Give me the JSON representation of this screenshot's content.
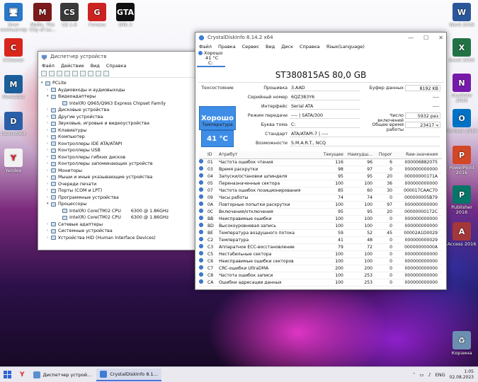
{
  "desktop": {
    "icons_left": [
      {
        "label": "Этот компьютер",
        "icon": "computer-icon"
      },
      {
        "label": "Mafia. The City of Lo...",
        "icon": "mafia-game-icon"
      },
      {
        "label": "CS 1.6",
        "icon": "cs-game-icon"
      },
      {
        "label": "Готика",
        "icon": "gothic-game-icon"
      },
      {
        "label": "GTA 3",
        "icon": "gta-game-icon"
      },
      {
        "label": "CCleaner",
        "icon": "ccleaner-icon"
      },
      {
        "label": "MediaGet",
        "icon": "mediaget-icon"
      },
      {
        "label": "DiskInfo64",
        "icon": "diskinfo-icon"
      },
      {
        "label": "Yandex",
        "icon": "yandex-icon"
      }
    ],
    "icons_right": [
      {
        "label": "Word 2016",
        "icon": "word-icon",
        "color": "#2b579a",
        "glyph": "W"
      },
      {
        "label": "Excel 2016",
        "icon": "excel-icon",
        "color": "#217346",
        "glyph": "X"
      },
      {
        "label": "OneNote 2016",
        "icon": "onenote-icon",
        "color": "#7719aa",
        "glyph": "N"
      },
      {
        "label": "Outlook 2016",
        "icon": "outlook-icon",
        "color": "#0072c6",
        "glyph": "O"
      },
      {
        "label": "PowerPoint 2016",
        "icon": "powerpoint-icon",
        "color": "#d24726",
        "glyph": "P"
      },
      {
        "label": "Publisher 2016",
        "icon": "publisher-icon",
        "color": "#077568",
        "glyph": "P"
      },
      {
        "label": "Access 2016",
        "icon": "access-icon",
        "color": "#a4373a",
        "glyph": "A"
      },
      {
        "label": "Корзина",
        "icon": "recycle-bin-icon",
        "color": "#6c8fb0",
        "glyph": "♻"
      }
    ]
  },
  "devmgr": {
    "title": "Диспетчер устройств",
    "menu": [
      "Файл",
      "Действие",
      "Вид",
      "Справка"
    ],
    "root": "PCLite",
    "tree": [
      {
        "label": "Аудиовходы и аудиовыходы",
        "expanded": false
      },
      {
        "label": "Видеоадаптеры",
        "expanded": true
      },
      {
        "label": "Intel(R) Q965/Q963 Express Chipset Family",
        "child": true
      },
      {
        "label": "Дисковые устройства",
        "expanded": false
      },
      {
        "label": "Другие устройства",
        "expanded": false
      },
      {
        "label": "Звуковые, игровые и видеоустройства",
        "expanded": false
      },
      {
        "label": "Клавиатуры",
        "expanded": false
      },
      {
        "label": "Компьютер",
        "expanded": false
      },
      {
        "label": "Контроллеры IDE ATA/ATAPI",
        "expanded": false
      },
      {
        "label": "Контроллеры USB",
        "expanded": false
      },
      {
        "label": "Контроллеры гибких дисков",
        "expanded": false
      },
      {
        "label": "Контроллеры запоминающих устройств",
        "expanded": false
      },
      {
        "label": "Мониторы",
        "expanded": false
      },
      {
        "label": "Мыши и иные указывающие устройства",
        "expanded": false
      },
      {
        "label": "Очереди печати",
        "expanded": false
      },
      {
        "label": "Порты (COM и LPT)",
        "expanded": false
      },
      {
        "label": "Программные устройства",
        "expanded": false
      },
      {
        "label": "Процессоры",
        "expanded": true
      },
      {
        "label": "Intel(R) Core(TM)2 CPU",
        "value": "6300 @ 1.86GHz",
        "child": true
      },
      {
        "label": "Intel(R) Core(TM)2 CPU",
        "value": "6300 @ 1.86GHz",
        "child": true
      },
      {
        "label": "Сетевые адаптеры",
        "expanded": false
      },
      {
        "label": "Системные устройства",
        "expanded": false
      },
      {
        "label": "Устройства HID (Human Interface Devices)",
        "expanded": false
      }
    ]
  },
  "cdi": {
    "title": "CrystalDiskInfo 8.14.2 x64",
    "menu": [
      "Файл",
      "Правка",
      "Сервис",
      "Вид",
      "Диск",
      "Справка",
      "Язык(Language)"
    ],
    "tab": {
      "status": "Хорошо",
      "temp": "41 °C",
      "letter": "C:"
    },
    "disk_title": "ST380815AS 80,0 GB",
    "labels": {
      "health": "Техсостояние",
      "temperature": "Температура",
      "firmware": "Прошивка",
      "serial": "Серийный номер",
      "interface": "Интерфейс",
      "transfer": "Режим передачи",
      "drive_letter": "Буква тома",
      "standard": "Стандарт",
      "features": "Возможности",
      "buffer": "Буфер данных",
      "power_on_count": "Число включений",
      "power_on_hours": "Общее время работы"
    },
    "values": {
      "health": "Хорошо",
      "temperature": "41 °C",
      "firmware": "3.AAD",
      "serial": "6QZ383Y6",
      "interface": "Serial ATA",
      "transfer": "---- | SATA/300",
      "drive_letter": "C:",
      "standard": "ATA/ATAPI-7 | ----",
      "features": "S.M.A.R.T., NCQ",
      "buffer": "8192 KB",
      "blank1": "----",
      "blank2": "----",
      "power_on_count": "5932 раз",
      "power_on_hours": "23417 ч"
    },
    "headers": [
      "ID",
      "Атрибут",
      "Текущее",
      "Наихудш...",
      "Порог",
      "Raw-значения"
    ],
    "rows": [
      [
        "01",
        "Частота ошибок чтения",
        "116",
        "96",
        "6",
        "000006882075"
      ],
      [
        "03",
        "Время раскрутки",
        "98",
        "97",
        "0",
        "000000000000"
      ],
      [
        "04",
        "Запуски/остановки шпинделя",
        "95",
        "95",
        "20",
        "00000000171A"
      ],
      [
        "05",
        "Переназначенные сектора",
        "100",
        "100",
        "36",
        "000000000000"
      ],
      [
        "07",
        "Частота ошибок позиционирования",
        "85",
        "60",
        "30",
        "000017CAAC70"
      ],
      [
        "09",
        "Часы работы",
        "74",
        "74",
        "0",
        "000000005B79"
      ],
      [
        "0A",
        "Повторные попытки раскрутки",
        "100",
        "100",
        "97",
        "000000000000"
      ],
      [
        "0C",
        "Включения/отключения",
        "95",
        "95",
        "20",
        "00000000172C"
      ],
      [
        "BB",
        "Неисправимые ошибки",
        "100",
        "100",
        "0",
        "000000000000"
      ],
      [
        "BD",
        "Высокоуровневая запись",
        "100",
        "100",
        "0",
        "000000000000"
      ],
      [
        "BE",
        "Температура воздушного потока",
        "59",
        "52",
        "45",
        "00002A1D0029"
      ],
      [
        "C2",
        "Температура",
        "41",
        "48",
        "0",
        "000000000029"
      ],
      [
        "C3",
        "Аппаратное ECC-восстановление",
        "79",
        "72",
        "0",
        "00000000000A"
      ],
      [
        "C5",
        "Нестабильные сектора",
        "100",
        "100",
        "0",
        "000000000000"
      ],
      [
        "C6",
        "Неисправимые ошибки секторов",
        "100",
        "100",
        "0",
        "000000000000"
      ],
      [
        "C7",
        "CRC-ошибки UltraDMA",
        "200",
        "200",
        "0",
        "000000000000"
      ],
      [
        "C8",
        "Частота ошибок записи",
        "100",
        "253",
        "0",
        "000000000000"
      ],
      [
        "CA",
        "Ошибки адресации данных",
        "100",
        "253",
        "0",
        "000000000000"
      ]
    ]
  },
  "taskbar": {
    "items": [
      {
        "label": "Диспетчер устрой...",
        "icon": "devmgr-taskbar-icon",
        "active": false
      },
      {
        "label": "CrystalDiskInfo 8.1...",
        "icon": "cdi-taskbar-icon",
        "active": true
      }
    ],
    "lang": "ENG",
    "time": "1:05",
    "date": "02.08.2023"
  },
  "colors": {
    "accent": "#3e8ee8",
    "good_dot": "#3b7dd8"
  }
}
